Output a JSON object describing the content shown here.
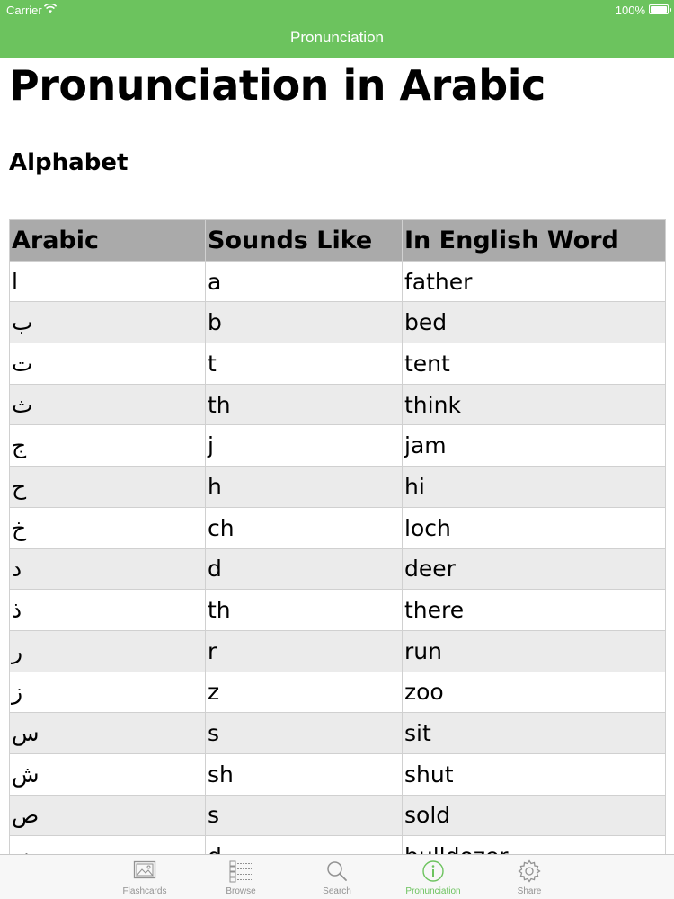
{
  "status_bar": {
    "carrier": "Carrier",
    "battery": "100%"
  },
  "nav": {
    "title": "Pronunciation"
  },
  "page": {
    "title": "Pronunciation in Arabic",
    "section": "Alphabet"
  },
  "table": {
    "headers": [
      "Arabic",
      "Sounds Like",
      "In English Word"
    ],
    "rows": [
      [
        "ا",
        "a",
        "father"
      ],
      [
        "ب",
        "b",
        "bed"
      ],
      [
        "ت",
        "t",
        "tent"
      ],
      [
        "ث",
        "th",
        "think"
      ],
      [
        "ج",
        "j",
        "jam"
      ],
      [
        "ح",
        "h",
        "hi"
      ],
      [
        "خ",
        "ch",
        "loch"
      ],
      [
        "د",
        "d",
        "deer"
      ],
      [
        "ذ",
        "th",
        "there"
      ],
      [
        "ر",
        "r",
        "run"
      ],
      [
        "ز",
        "z",
        "zoo"
      ],
      [
        "س",
        "s",
        "sit"
      ],
      [
        "ش",
        "sh",
        "shut"
      ],
      [
        "ص",
        "s",
        "sold"
      ],
      [
        "ض",
        "d",
        "bulldozer"
      ]
    ]
  },
  "tabbar": {
    "tabs": [
      {
        "label": "Flashcards",
        "icon": "image-icon",
        "active": false
      },
      {
        "label": "Browse",
        "icon": "list-icon",
        "active": false
      },
      {
        "label": "Search",
        "icon": "search-icon",
        "active": false
      },
      {
        "label": "Pronunciation",
        "icon": "info-icon",
        "active": true
      },
      {
        "label": "Share",
        "icon": "gear-icon",
        "active": false
      }
    ]
  },
  "colors": {
    "accent": "#6cc35e",
    "table_header": "#aaaaaa",
    "row_alt": "#ebebeb",
    "tab_inactive": "#929292"
  }
}
